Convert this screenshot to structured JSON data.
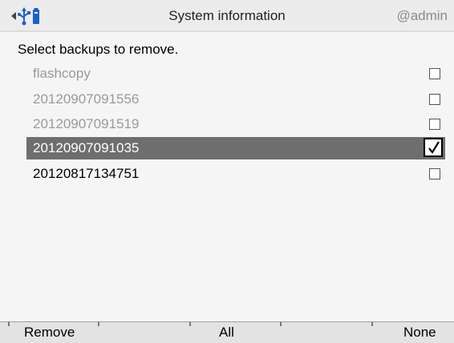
{
  "header": {
    "title": "System information",
    "user": "@admin",
    "icons": [
      "back-arrow-icon",
      "usb-icon",
      "storage-icon"
    ]
  },
  "instruction": "Select backups to remove.",
  "backups": [
    {
      "label": "flashcopy",
      "checked": false,
      "enabled": false
    },
    {
      "label": "20120907091556",
      "checked": false,
      "enabled": false
    },
    {
      "label": "20120907091519",
      "checked": false,
      "enabled": false
    },
    {
      "label": "20120907091035",
      "checked": true,
      "enabled": true,
      "selected": true
    },
    {
      "label": "20120817134751",
      "checked": false,
      "enabled": true
    }
  ],
  "footer": {
    "remove_label": "Remove",
    "all_label": "All",
    "none_label": "None"
  },
  "colors": {
    "selected_row": "#6e6e6e",
    "disabled_text": "#9a9a9a",
    "icon_blue": "#1a5fd0"
  }
}
